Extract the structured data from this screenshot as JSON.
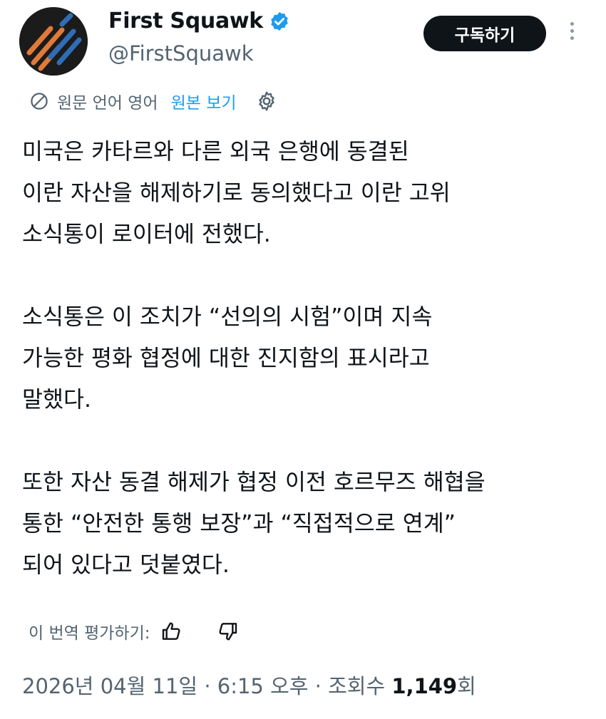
{
  "header": {
    "display_name": "First Squawk",
    "handle": "@FirstSquawk",
    "subscribe_label": "구독하기",
    "icons": {
      "avatar": "first-squawk-logo",
      "verified": "verified-badge-icon",
      "more": "more-vertical-icon"
    },
    "colors": {
      "verified": "#1d9bf0",
      "avatar_orange": "#e07a3a",
      "avatar_blue": "#2f6db6"
    }
  },
  "translation": {
    "source_language_label": "원문 언어 영어",
    "view_original_label": "원본 보기",
    "icons": {
      "translate": "translate-globe-icon",
      "settings": "gear-icon"
    }
  },
  "tweet": {
    "paragraphs": [
      [
        "미국은 카타르와 다른 외국 은행에 동결된",
        "이란 자산을 해제하기로 동의했다고 이란 고위",
        "소식통이 로이터에 전했다."
      ],
      [
        "소식통은 이 조치가 “선의의 시험”이며 지속",
        "가능한 평화 협정에 대한 진지함의 표시라고",
        "말했다."
      ],
      [
        "또한 자산 동결 해제가 협정 이전 호르무즈 해협을",
        "통한 “안전한 통행 보장”과 “직접적으로 연계”",
        "되어 있다고 덧붙였다."
      ]
    ]
  },
  "rating": {
    "label": "이 번역 평가하기:",
    "icons": {
      "up": "thumbs-up-icon",
      "down": "thumbs-down-icon"
    }
  },
  "meta": {
    "date": "2026년 04월 11일",
    "separator": "·",
    "time": "6:15 오후",
    "views_label": "조회수",
    "views_count": "1,149",
    "views_suffix": "회"
  },
  "colors": {
    "text": "#0f1419",
    "muted": "#536471",
    "link": "#1d9bf0",
    "button_bg": "#0f1419"
  }
}
